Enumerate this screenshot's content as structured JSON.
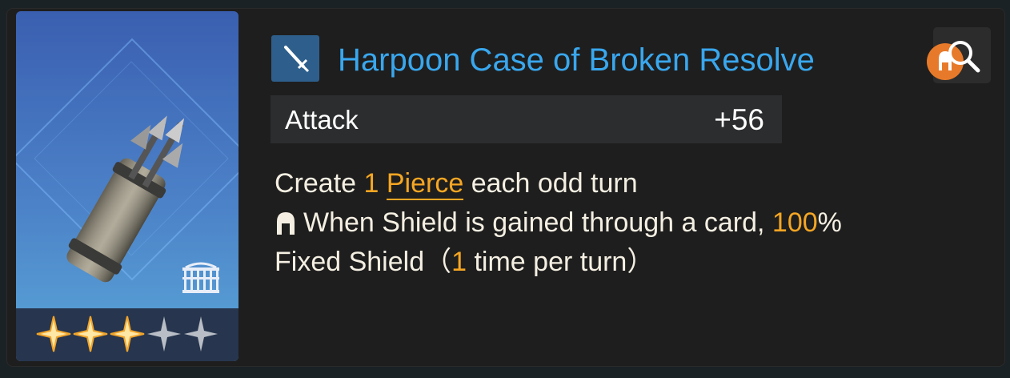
{
  "item": {
    "name": "Harpoon Case of Broken Resolve",
    "rarity_stars_filled": 3,
    "rarity_stars_total": 5,
    "weapon_type_icon": "sword-icon",
    "class_icon": "arena-colosseum-icon",
    "art_icon": "harpoon-quiver-icon"
  },
  "stat": {
    "label": "Attack",
    "value": "+56"
  },
  "effects": {
    "line1": {
      "prefix": "Create ",
      "count": "1",
      "keyword": "Pierce",
      "suffix": " each odd turn"
    },
    "line2": {
      "icon": "spartan-helmet-icon",
      "text": "When Shield is gained through a card, ",
      "value": "100",
      "unit": "%"
    },
    "line3": {
      "text1": "Fixed Shield（",
      "value": "1",
      "text2": " time per turn）"
    }
  },
  "search": {
    "icon": "magnifier-icon",
    "badge_icon": "spartan-helmet-icon"
  },
  "colors": {
    "title": "#39a7ee",
    "highlight": "#f5a623",
    "panel": "#1e1e1e",
    "stat_row": "#2b2d2f"
  }
}
